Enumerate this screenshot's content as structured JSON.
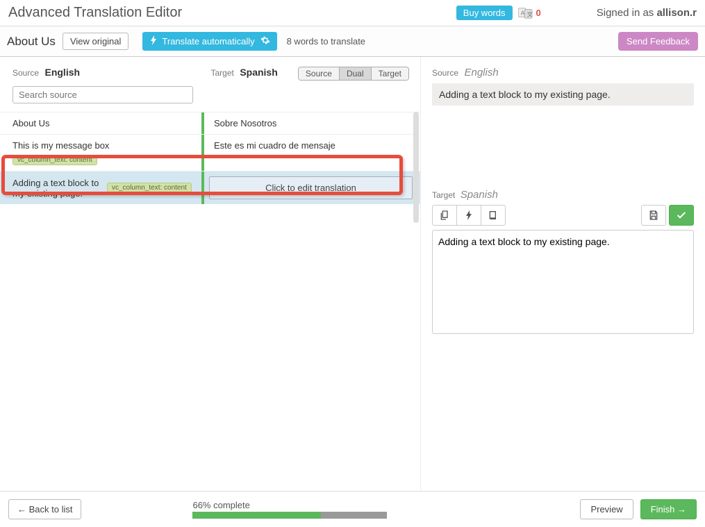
{
  "header": {
    "title": "Advanced Translation Editor",
    "buy_words": "Buy words",
    "pending_count": "0",
    "signed_in_prefix": "Signed in as ",
    "user": "allison.r"
  },
  "subheader": {
    "page_name": "About Us",
    "view_original": "View original",
    "translate_auto": "Translate automatically",
    "words_to_translate": "8 words to translate",
    "send_feedback": "Send Feedback"
  },
  "labels": {
    "source": "Source",
    "target": "Target",
    "source_lang": "English",
    "target_lang": "Spanish",
    "view_source": "Source",
    "view_dual": "Dual",
    "view_target": "Target",
    "search_placeholder": "Search source"
  },
  "rows": [
    {
      "src": "About Us",
      "tgt": "Sobre Nosotros",
      "tag": ""
    },
    {
      "src": "This is my message box",
      "tgt": "Este es mi cuadro de mensaje",
      "tag": "vc_column_text: content"
    },
    {
      "src": "Adding a text block to my existing page.",
      "tgt_placeholder": "Click to edit translation",
      "tag": "vc_column_text: content",
      "highlight": true
    }
  ],
  "right_panel": {
    "source_label": "Source",
    "source_lang": "English",
    "source_text": "Adding a text block to my existing page.",
    "target_label": "Target",
    "target_lang": "Spanish",
    "editor_value": "Adding a text block to my existing page."
  },
  "footer": {
    "back": "← Back to list",
    "progress_label": "66% complete",
    "progress_pct": 66,
    "preview": "Preview",
    "finish": "Finish →"
  }
}
